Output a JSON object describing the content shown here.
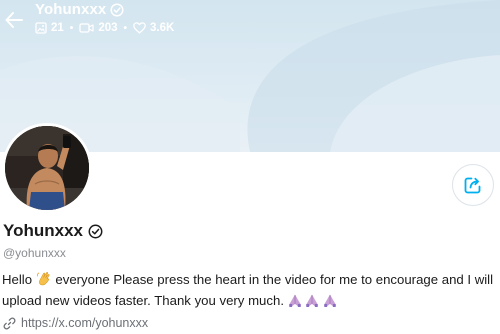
{
  "header": {
    "title": "Yohunxxx",
    "stats": {
      "photos": "21",
      "videos": "203",
      "likes": "3.6K"
    }
  },
  "profile": {
    "display_name": "Yohunxxx",
    "handle": "@yohunxxx",
    "bio_part1": "Hello",
    "bio_part2": "everyone Please press the heart in the video for me to encourage and I will upload new videos faster. Thank you very much.",
    "link": "https://x.com/yohunxxx"
  },
  "icons": {
    "back": "arrow-left-icon",
    "verified": "verified-badge-icon",
    "photos": "image-icon",
    "videos": "video-camera-icon",
    "likes": "heart-icon",
    "share": "share-icon",
    "link": "link-icon",
    "wave": "waving-hand-emoji",
    "pray": "folded-hands-emoji"
  },
  "colors": {
    "accent": "#00aff0",
    "cover": "#d3e5ef",
    "text": "#1b1b1b",
    "muted": "#8a8d91"
  }
}
